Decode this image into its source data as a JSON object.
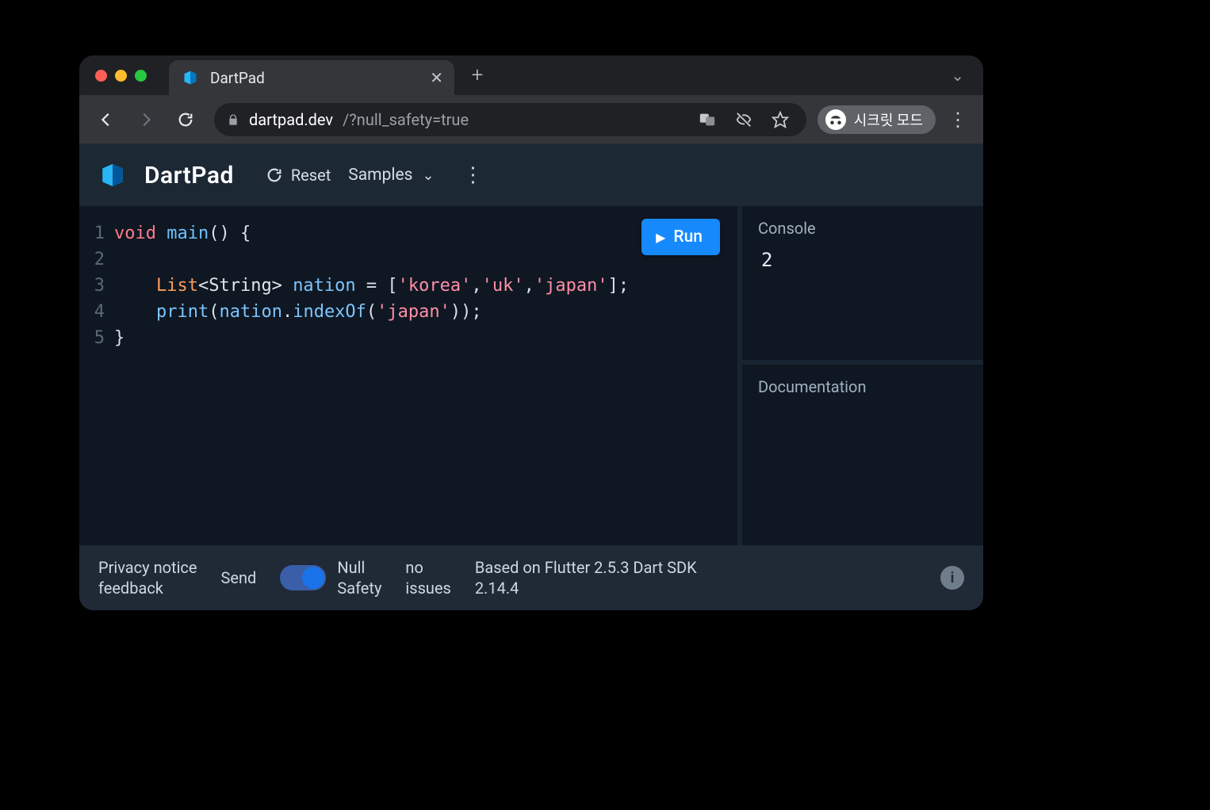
{
  "browser": {
    "tab_title": "DartPad",
    "url_host": "dartpad.dev",
    "url_path": "/?null_safety=true",
    "incognito_label": "시크릿 모드"
  },
  "app": {
    "brand": "DartPad",
    "reset_label": "Reset",
    "samples_label": "Samples",
    "run_label": "Run"
  },
  "editor": {
    "line_numbers": [
      "1",
      "2",
      "3",
      "4",
      "5"
    ],
    "lines": [
      [
        {
          "t": "void",
          "c": "tok-kw"
        },
        {
          "t": " ",
          "c": "tok-punc"
        },
        {
          "t": "main",
          "c": "tok-fn"
        },
        {
          "t": "() {",
          "c": "tok-punc"
        }
      ],
      [],
      [
        {
          "t": "    ",
          "c": "tok-punc"
        },
        {
          "t": "List",
          "c": "tok-type"
        },
        {
          "t": "<String>",
          "c": "tok-gen"
        },
        {
          "t": " ",
          "c": "tok-punc"
        },
        {
          "t": "nation",
          "c": "tok-id"
        },
        {
          "t": " = [",
          "c": "tok-punc"
        },
        {
          "t": "'korea'",
          "c": "tok-str"
        },
        {
          "t": ",",
          "c": "tok-punc"
        },
        {
          "t": "'uk'",
          "c": "tok-str"
        },
        {
          "t": ",",
          "c": "tok-punc"
        },
        {
          "t": "'japan'",
          "c": "tok-str"
        },
        {
          "t": "];",
          "c": "tok-punc"
        }
      ],
      [
        {
          "t": "    ",
          "c": "tok-punc"
        },
        {
          "t": "print",
          "c": "tok-id"
        },
        {
          "t": "(",
          "c": "tok-punc"
        },
        {
          "t": "nation",
          "c": "tok-id"
        },
        {
          "t": ".",
          "c": "tok-punc"
        },
        {
          "t": "indexOf",
          "c": "tok-id"
        },
        {
          "t": "(",
          "c": "tok-punc"
        },
        {
          "t": "'japan'",
          "c": "tok-str"
        },
        {
          "t": "));",
          "c": "tok-punc"
        }
      ],
      [
        {
          "t": "}",
          "c": "tok-punc"
        }
      ]
    ]
  },
  "side": {
    "console_title": "Console",
    "console_output": "2",
    "docs_title": "Documentation"
  },
  "footer": {
    "privacy_line1": "Privacy notice",
    "privacy_line2": "feedback",
    "send_label": "Send",
    "null_safety_line1": "Null",
    "null_safety_line2": "Safety",
    "issues_line1": "no",
    "issues_line2": "issues",
    "sdk_line1": "Based on Flutter 2.5.3 Dart SDK",
    "sdk_line2": "2.14.4"
  }
}
